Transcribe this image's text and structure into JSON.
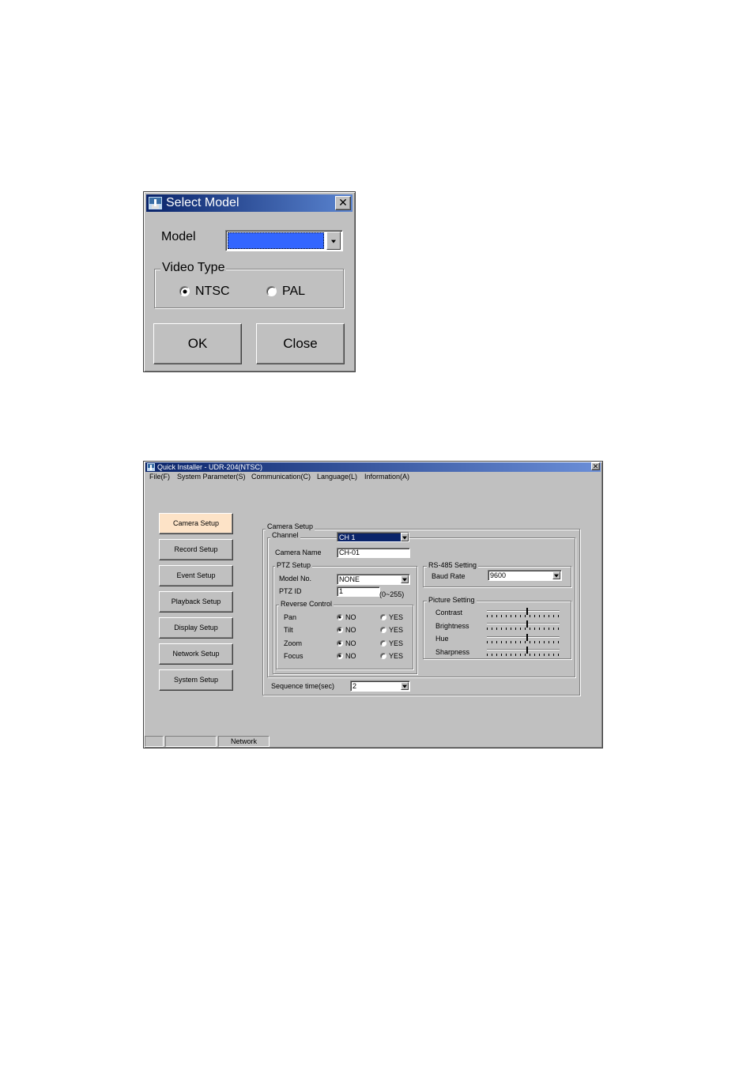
{
  "select_model": {
    "title": "Select Model",
    "close_glyph": "✕",
    "model_label": "Model",
    "model_value": "",
    "video_type": {
      "legend": "Video Type",
      "options": [
        "NTSC",
        "PAL"
      ],
      "selected": "NTSC"
    },
    "ok_label": "OK",
    "close_label": "Close",
    "colors": {
      "model_field_fill": "#3366ff",
      "titlebar": "#0a246a"
    }
  },
  "quick_installer": {
    "title": "Quick Installer - UDR-204(NTSC)",
    "close_glyph": "✕",
    "menu": [
      "File(F)",
      "System Parameter(S)",
      "Communication(C)",
      "Language(L)",
      "Information(A)"
    ],
    "nav": [
      "Camera Setup",
      "Record Setup",
      "Event Setup",
      "Playback Setup",
      "Display Setup",
      "Network Setup",
      "System Setup"
    ],
    "nav_active": "Camera Setup",
    "camera_setup": {
      "legend": "Camera Setup",
      "channel": {
        "legend": "Channel",
        "value": "CH 1"
      },
      "camera_name": {
        "label": "Camera Name",
        "value": "CH-01"
      },
      "ptz": {
        "legend": "PTZ Setup",
        "model_label": "Model No.",
        "model_value": "NONE",
        "id_label": "PTZ ID",
        "id_value": "1",
        "id_range": "(0~255)",
        "reverse": {
          "legend": "Reverse Control",
          "rows": [
            {
              "label": "Pan",
              "no": "NO",
              "yes": "YES",
              "selected": "NO"
            },
            {
              "label": "Tilt",
              "no": "NO",
              "yes": "YES",
              "selected": "NO"
            },
            {
              "label": "Zoom",
              "no": "NO",
              "yes": "YES",
              "selected": "NO"
            },
            {
              "label": "Focus",
              "no": "NO",
              "yes": "YES",
              "selected": "NO"
            }
          ]
        }
      },
      "rs485": {
        "legend": "RS-485 Setting",
        "baud_label": "Baud Rate",
        "baud_value": "9600"
      },
      "picture": {
        "legend": "Picture Setting",
        "sliders": [
          {
            "label": "Contrast",
            "level": 0.55
          },
          {
            "label": "Brightness",
            "level": 0.55
          },
          {
            "label": "Hue",
            "level": 0.55
          },
          {
            "label": "Sharpness",
            "level": 0.55
          }
        ]
      },
      "sequence": {
        "label": "Sequence time(sec)",
        "value": "2"
      }
    },
    "status_bar": [
      "",
      "",
      "Network"
    ],
    "colors": {
      "active_nav": "#fde3c7",
      "window_face": "#c0c0c0"
    }
  }
}
